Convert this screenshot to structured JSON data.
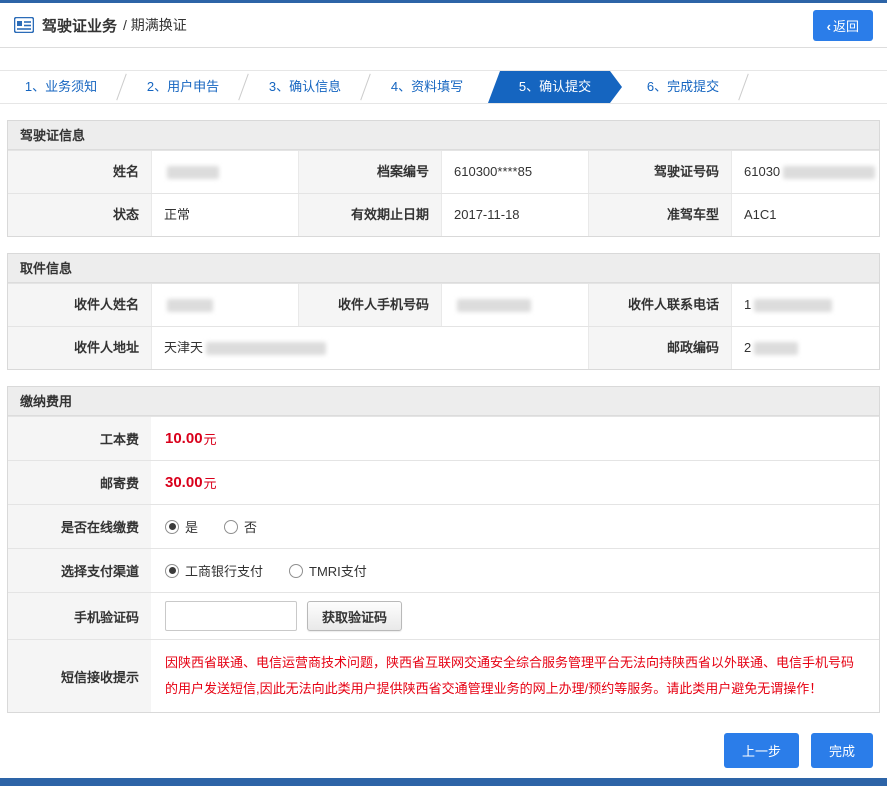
{
  "header": {
    "title": "驾驶证业务",
    "subtitle": "/ 期满换证",
    "back_chevron": "‹",
    "back_label": "返回"
  },
  "steps": [
    {
      "label": "1、业务须知"
    },
    {
      "label": "2、用户申告"
    },
    {
      "label": "3、确认信息"
    },
    {
      "label": "4、资料填写"
    },
    {
      "label": "5、确认提交"
    },
    {
      "label": "6、完成提交"
    }
  ],
  "active_step": "5、确认提交",
  "license": {
    "title": "驾驶证信息",
    "name_label": "姓名",
    "file_label": "档案编号",
    "file_value": "610300****85",
    "number_label": "驾驶证号码",
    "number_value_prefix": "61030",
    "status_label": "状态",
    "status_value": "正常",
    "expiry_label": "有效期止日期",
    "expiry_value": "2017-11-18",
    "vehicle_label": "准驾车型",
    "vehicle_value": "A1C1"
  },
  "pickup": {
    "title": "取件信息",
    "recipient_name_label": "收件人姓名",
    "recipient_mobile_label": "收件人手机号码",
    "recipient_phone_label": "收件人联系电话",
    "recipient_phone_prefix": "1",
    "address_label": "收件人地址",
    "address_prefix": "天津天",
    "postcode_label": "邮政编码",
    "postcode_prefix": "2"
  },
  "fees": {
    "title": "缴纳费用",
    "production_fee_label": "工本费",
    "production_fee_amount": "10.00",
    "production_fee_unit": "元",
    "postage_fee_label": "邮寄费",
    "postage_fee_amount": "30.00",
    "postage_fee_unit": "元",
    "online_pay_label": "是否在线缴费",
    "online_pay_yes": "是",
    "online_pay_no": "否",
    "channel_label": "选择支付渠道",
    "channel_icbc": "工商银行支付",
    "channel_tmri": "TMRI支付",
    "captcha_label": "手机验证码",
    "captcha_value": "",
    "captcha_button": "获取验证码",
    "sms_label": "短信接收提示",
    "sms_notice": "因陕西省联通、电信运营商技术问题，陕西省互联网交通安全综合服务管理平台无法向持陕西省以外联通、电信手机号码的用户发送短信,因此无法向此类用户提供陕西省交通管理业务的网上办理/预约等服务。请此类用户避免无谓操作！"
  },
  "actions": {
    "prev": "上一步",
    "finish": "完成"
  },
  "colors": {
    "accent_blue": "#2b7de9",
    "step_blue": "#1565c0",
    "alert_red": "#e60012",
    "fee_red": "#d9001b",
    "bar_navy": "#2d64a7"
  }
}
